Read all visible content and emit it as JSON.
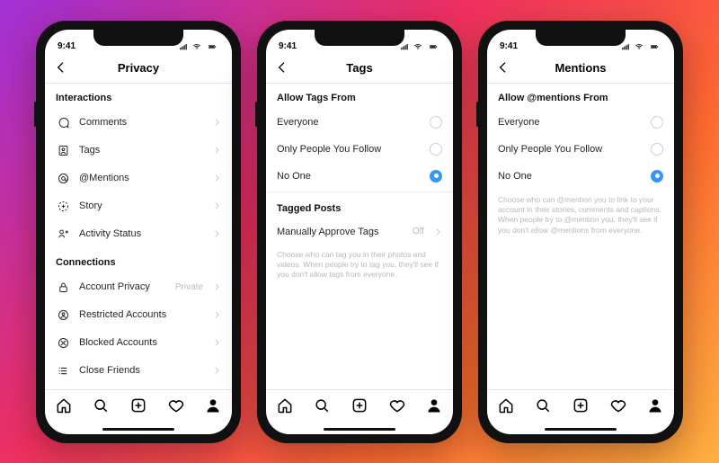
{
  "status_time": "9:41",
  "phone1": {
    "title": "Privacy",
    "sections": [
      {
        "header": "Interactions",
        "rows": [
          {
            "icon": "comment",
            "label": "Comments"
          },
          {
            "icon": "tag",
            "label": "Tags"
          },
          {
            "icon": "mention",
            "label": "@Mentions"
          },
          {
            "icon": "story",
            "label": "Story"
          },
          {
            "icon": "activity",
            "label": "Activity Status"
          }
        ]
      },
      {
        "header": "Connections",
        "rows": [
          {
            "icon": "lock",
            "label": "Account Privacy",
            "meta": "Private"
          },
          {
            "icon": "restrict",
            "label": "Restricted Accounts"
          },
          {
            "icon": "block",
            "label": "Blocked Accounts"
          },
          {
            "icon": "list",
            "label": "Close Friends"
          }
        ]
      }
    ]
  },
  "phone2": {
    "title": "Tags",
    "radio_header": "Allow Tags From",
    "options": [
      {
        "label": "Everyone",
        "selected": false
      },
      {
        "label": "Only People You Follow",
        "selected": false
      },
      {
        "label": "No One",
        "selected": true
      }
    ],
    "section2_header": "Tagged Posts",
    "approve_label": "Manually Approve Tags",
    "approve_value": "Off",
    "helper": "Choose who can tag you in their photos and videos. When people try to tag you, they'll see if you don't allow tags from everyone."
  },
  "phone3": {
    "title": "Mentions",
    "radio_header": "Allow @mentions From",
    "options": [
      {
        "label": "Everyone",
        "selected": false
      },
      {
        "label": "Only People You Follow",
        "selected": false
      },
      {
        "label": "No One",
        "selected": true
      }
    ],
    "helper": "Choose who can @mention you to link to your account in their stories, comments and captions. When people try to @mention you, they'll see if you don't allow @mentions from everyone."
  }
}
